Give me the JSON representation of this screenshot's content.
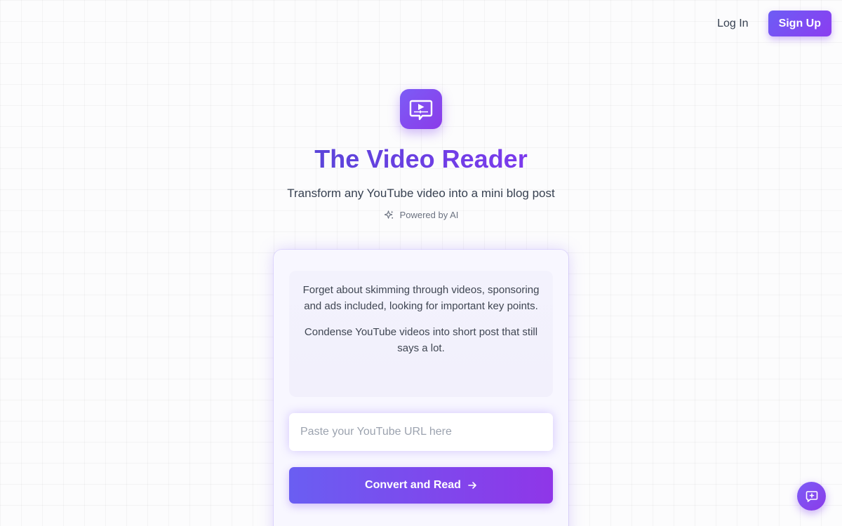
{
  "nav": {
    "login_label": "Log In",
    "signup_label": "Sign Up"
  },
  "hero": {
    "logo_icon": "video-chat-icon",
    "title": "The Video Reader",
    "subtitle": "Transform any YouTube video into a mini blog post",
    "powered_label": "Powered by AI",
    "powered_icon": "sparkles-icon"
  },
  "card": {
    "description_1": "Forget about skimming through videos, sponsoring and ads included, looking for important key points.",
    "description_2": "Condense YouTube videos into short post that still says a lot.",
    "url_input": {
      "value": "",
      "placeholder": "Paste your YouTube URL here"
    },
    "convert_label": "Convert and Read",
    "convert_icon": "arrow-right-icon"
  },
  "chat_fab": {
    "icon": "message-plus-icon"
  },
  "colors": {
    "accent": "#7c3aed",
    "accent_start": "#6a5ef2",
    "accent_end": "#8f36e8",
    "text": "#374151",
    "muted": "#6b7280"
  }
}
